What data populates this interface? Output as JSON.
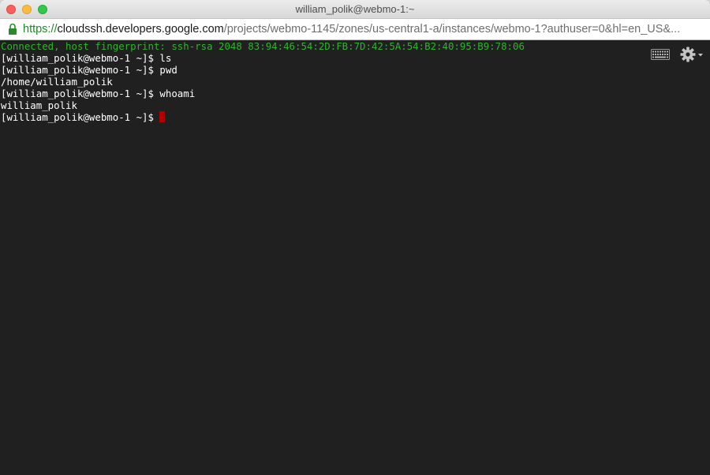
{
  "window": {
    "title": "william_polik@webmo-1:~"
  },
  "address_bar": {
    "scheme": "https://",
    "host": "cloudssh.developers.google.com",
    "path": "/projects/webmo-1145/zones/us-central1-a/instances/webmo-1?authuser=0&hl=en_US&..."
  },
  "terminal": {
    "connected_line": "Connected, host fingerprint: ssh-rsa 2048 83:94:46:54:2D:FB:7D:42:5A:54:B2:40:95:B9:78:06",
    "lines": [
      "[william_polik@webmo-1 ~]$ ls",
      "[william_polik@webmo-1 ~]$ pwd",
      "/home/william_polik",
      "[william_polik@webmo-1 ~]$ whoami",
      "william_polik"
    ],
    "prompt": "[william_polik@webmo-1 ~]$ ",
    "cursor_color": "#b00000"
  },
  "toolbar": {
    "keyboard_icon": "keyboard-icon",
    "settings_icon": "gear-icon"
  },
  "colors": {
    "terminal_bg": "#202020",
    "connected_text": "#2bb52b",
    "scheme_green": "#1d8a25"
  }
}
